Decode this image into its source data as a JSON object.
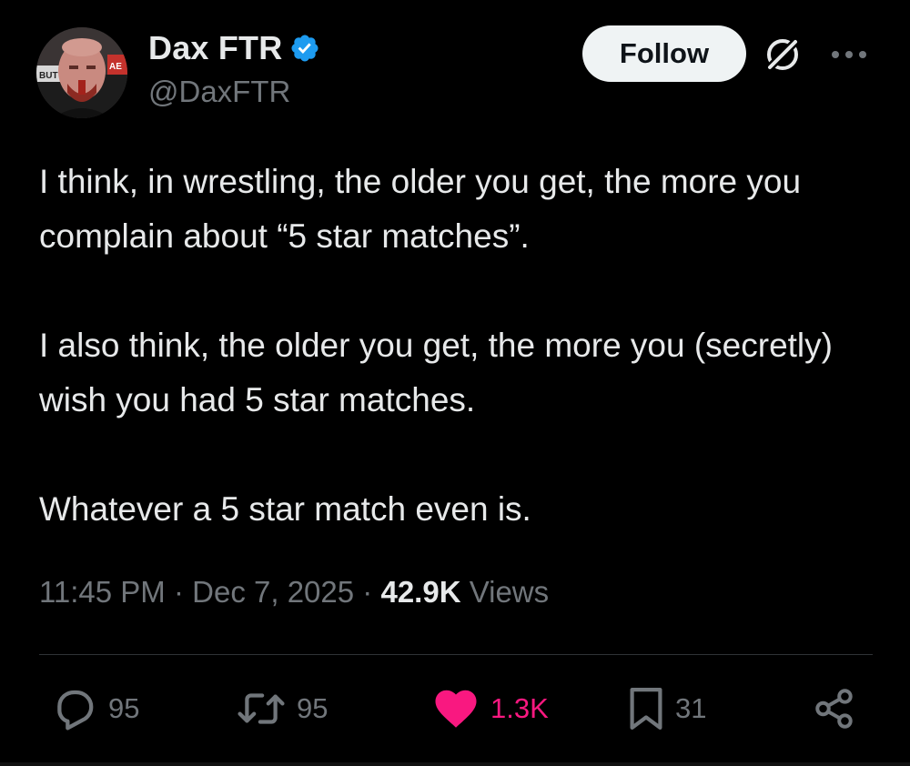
{
  "author": {
    "display_name": "Dax FTR",
    "handle": "@DaxFTR",
    "verified": true,
    "verified_color": "#1d9bf0",
    "avatar_icon": "profile-photo",
    "avatar_text": [
      "BUT",
      "AE"
    ]
  },
  "header": {
    "follow_label": "Follow",
    "grok_icon": "grok-icon",
    "more_icon": "more-icon"
  },
  "tweet": {
    "paragraphs": [
      "I think, in wrestling, the older you get, the more you complain about “5 star matches”.",
      "I also think, the older you get, the more you (secretly) wish you had 5 star matches.",
      "Whatever a 5 star match even is."
    ],
    "time": "11:45 PM",
    "separator": "·",
    "date": "Dec 7, 2025",
    "views_count": "42.9K",
    "views_label": "Views"
  },
  "actions": {
    "replies": "95",
    "reposts": "95",
    "likes": "1.3K",
    "bookmarks": "31",
    "liked": true,
    "like_color": "#f91880"
  },
  "colors": {
    "background": "#000000",
    "text": "#e7e9ea",
    "muted": "#71767b",
    "divider": "#2f3336"
  }
}
